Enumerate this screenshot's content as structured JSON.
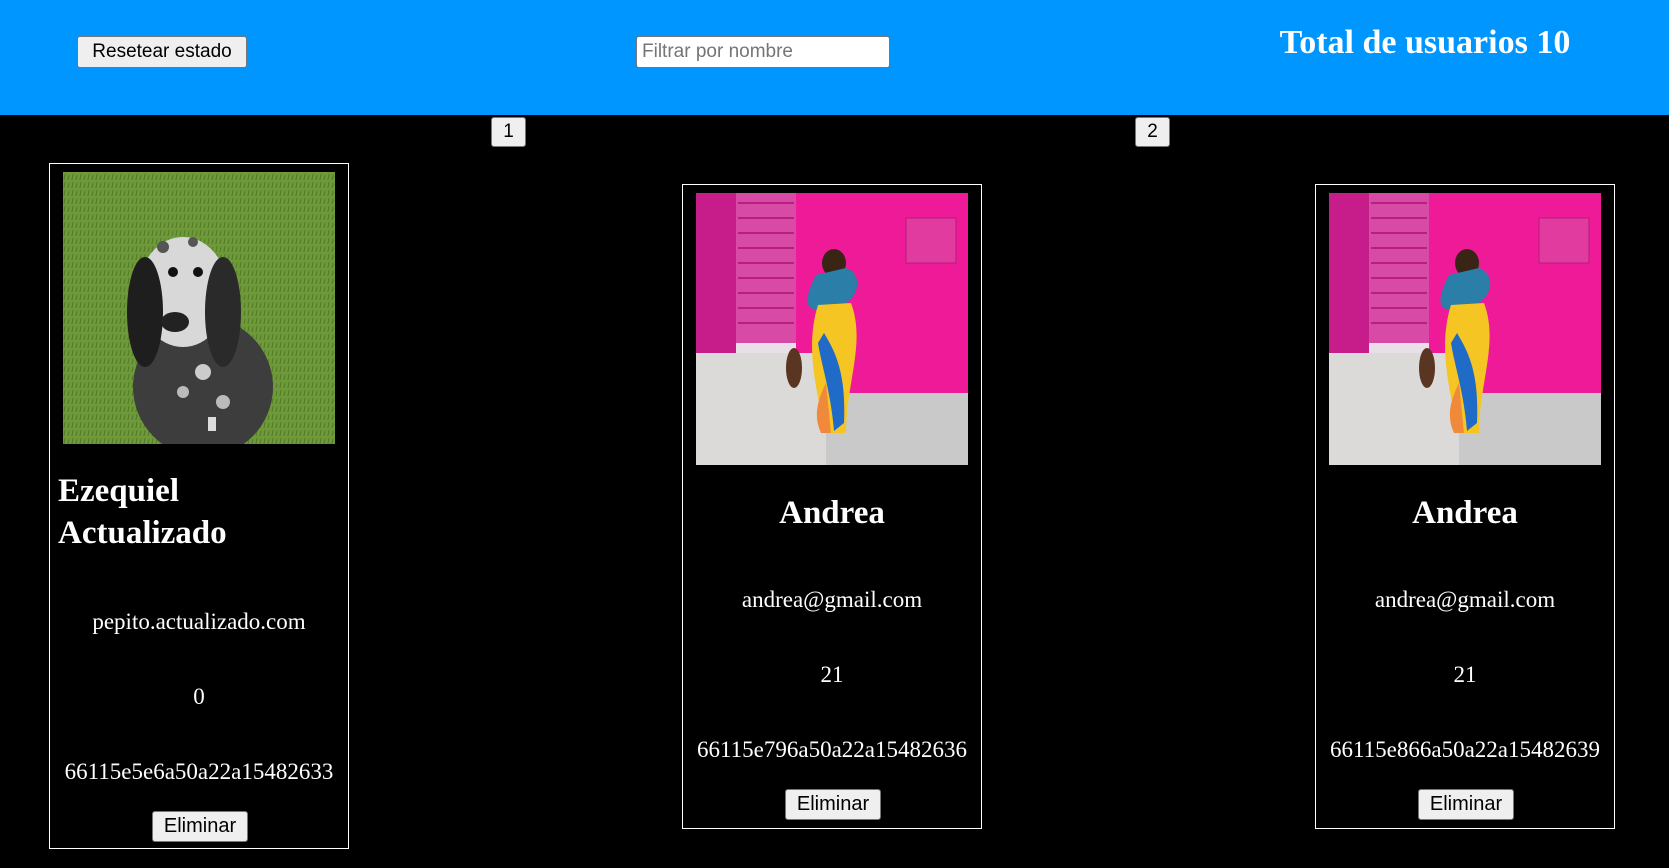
{
  "header": {
    "reset_label": "Resetear estado",
    "filter_placeholder": "Filtrar por nombre",
    "filter_value": "",
    "total_label": "Total de usuarios 10"
  },
  "pagination": {
    "pages": [
      "1",
      "2"
    ]
  },
  "users": [
    {
      "name": "Ezequiel Actualizado",
      "email": "pepito.actualizado.com",
      "age": "0",
      "id": "66115e5e6a50a22a15482633",
      "delete_label": "Eliminar",
      "photo_icon": "dog-photo-icon"
    },
    {
      "name": "Andrea",
      "email": "andrea@gmail.com",
      "age": "21",
      "id": "66115e796a50a22a15482636",
      "delete_label": "Eliminar",
      "photo_icon": "woman-photo-icon"
    },
    {
      "name": "Andrea",
      "email": "andrea@gmail.com",
      "age": "21",
      "id": "66115e866a50a22a15482639",
      "delete_label": "Eliminar",
      "photo_icon": "woman-photo-icon"
    }
  ],
  "colors": {
    "header_bg": "#0096ff",
    "page_bg": "#000000",
    "text": "#ffffff"
  }
}
